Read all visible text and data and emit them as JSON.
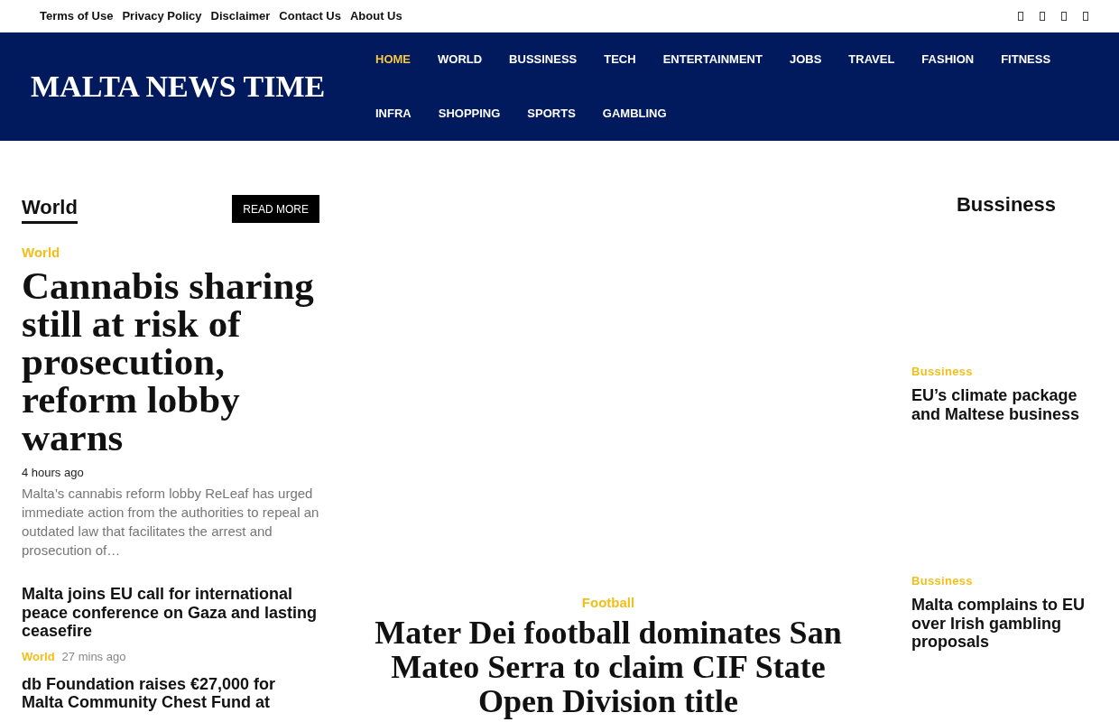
{
  "top_bar": {
    "links": [
      "Terms of Use",
      "Privacy Policy",
      "Disclaimer",
      "Contact Us",
      "About Us"
    ]
  },
  "header": {
    "logo": "MALTA NEWS TIME",
    "nav": [
      {
        "label": "HOME",
        "selected": true
      },
      {
        "label": "WORLD",
        "selected": false
      },
      {
        "label": "BUSSINESS",
        "selected": false
      },
      {
        "label": "TECH",
        "selected": false
      },
      {
        "label": "ENTERTAINMENT",
        "selected": false
      },
      {
        "label": "JOBS",
        "selected": false
      },
      {
        "label": "TRAVEL",
        "selected": false
      },
      {
        "label": "FASHION",
        "selected": false
      },
      {
        "label": "FITNESS",
        "selected": false
      },
      {
        "label": "INFRA",
        "selected": false
      },
      {
        "label": "SHOPPING",
        "selected": false
      },
      {
        "label": "SPORTS",
        "selected": false
      },
      {
        "label": "GAMBLING",
        "selected": false
      }
    ]
  },
  "left_section": {
    "title": "World",
    "button": "READ MORE",
    "lead": {
      "category": "World",
      "title": "Cannabis sharing still at risk of prosecution, reform lobby warns",
      "time": "4 hours ago",
      "excerpt": "Malta’s cannabis reform lobby ReLeaf has urged immediate action from the authorities to repeal an outdated law that facilitates the arrest and prosecution of…"
    },
    "items": [
      {
        "title": "Malta joins EU call for international peace conference on Gaza and lasting ceasefire",
        "category": "World",
        "time": "27 mins ago"
      },
      {
        "title": "db Foundation raises €27,000 for Malta Community Chest Fund at"
      }
    ]
  },
  "center_story": {
    "category": "Football",
    "title": "Mater Dei football dominates San Mateo Serra to claim CIF State Open Division title"
  },
  "right_section": {
    "title": "Bussiness",
    "items": [
      {
        "category": "Bussiness",
        "title": "EU’s climate package and Maltese business"
      },
      {
        "category": "Bussiness",
        "title": "Malta complains to EU over Irish gambling proposals"
      }
    ]
  }
}
